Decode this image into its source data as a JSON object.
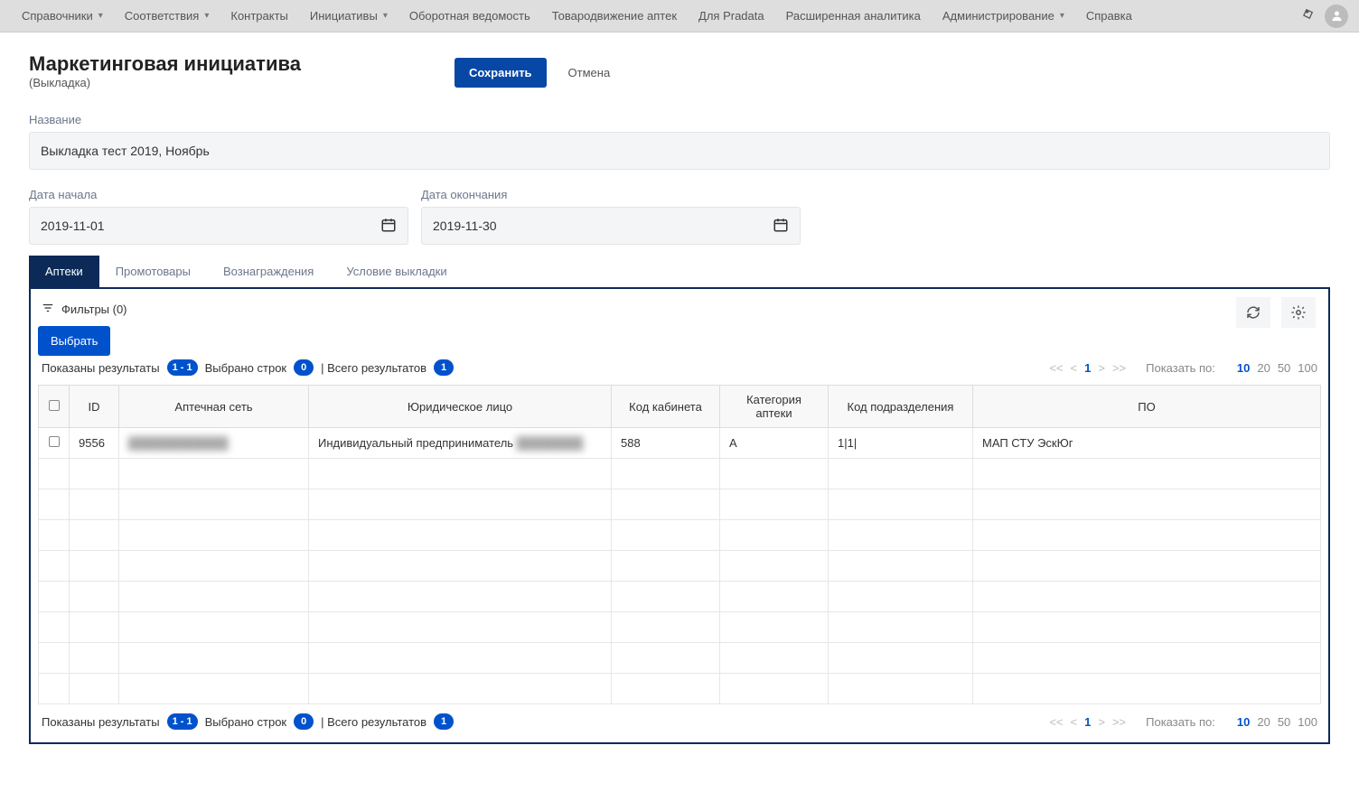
{
  "topnav": {
    "items": [
      {
        "label": "Справочники",
        "dropdown": true
      },
      {
        "label": "Соответствия",
        "dropdown": true
      },
      {
        "label": "Контракты",
        "dropdown": false
      },
      {
        "label": "Инициативы",
        "dropdown": true
      },
      {
        "label": "Оборотная ведомость",
        "dropdown": false
      },
      {
        "label": "Товародвижение аптек",
        "dropdown": false
      },
      {
        "label": "Для Pradata",
        "dropdown": false
      },
      {
        "label": "Расширенная аналитика",
        "dropdown": false
      },
      {
        "label": "Администрирование",
        "dropdown": true
      },
      {
        "label": "Справка",
        "dropdown": false
      }
    ]
  },
  "header": {
    "title": "Маркетинговая инициатива",
    "subtitle": "(Выкладка)",
    "save_label": "Сохранить",
    "cancel_label": "Отмена"
  },
  "form": {
    "name_label": "Название",
    "name_value": "Выкладка тест 2019, Ноябрь",
    "start_label": "Дата начала",
    "start_value": "2019-11-01",
    "end_label": "Дата окончания",
    "end_value": "2019-11-30"
  },
  "tabs": [
    "Аптеки",
    "Промотовары",
    "Вознаграждения",
    "Условие выкладки"
  ],
  "toolbar": {
    "filters_label": "Фильтры (0)",
    "select_label": "Выбрать"
  },
  "status": {
    "results_label": "Показаны результаты",
    "results_badge": "1 - 1",
    "selected_label": "Выбрано строк",
    "selected_badge": "0",
    "total_label": "| Всего результатов",
    "total_badge": "1",
    "show_by_label": "Показать по:",
    "page_sizes": [
      "10",
      "20",
      "50",
      "100"
    ],
    "current_page": "1"
  },
  "table": {
    "headers": [
      "ID",
      "Аптечная сеть",
      "Юридическое лицо",
      "Код кабинета",
      "Категория аптеки",
      "Код подразделения",
      "ПО"
    ],
    "rows": [
      {
        "id": "9556",
        "network": "",
        "legal": "Индивидуальный предприниматель",
        "code": "588",
        "category": "А",
        "dept": "1|1|",
        "po": "МАП СТУ ЭскЮг"
      }
    ],
    "empty_rows": 8
  }
}
